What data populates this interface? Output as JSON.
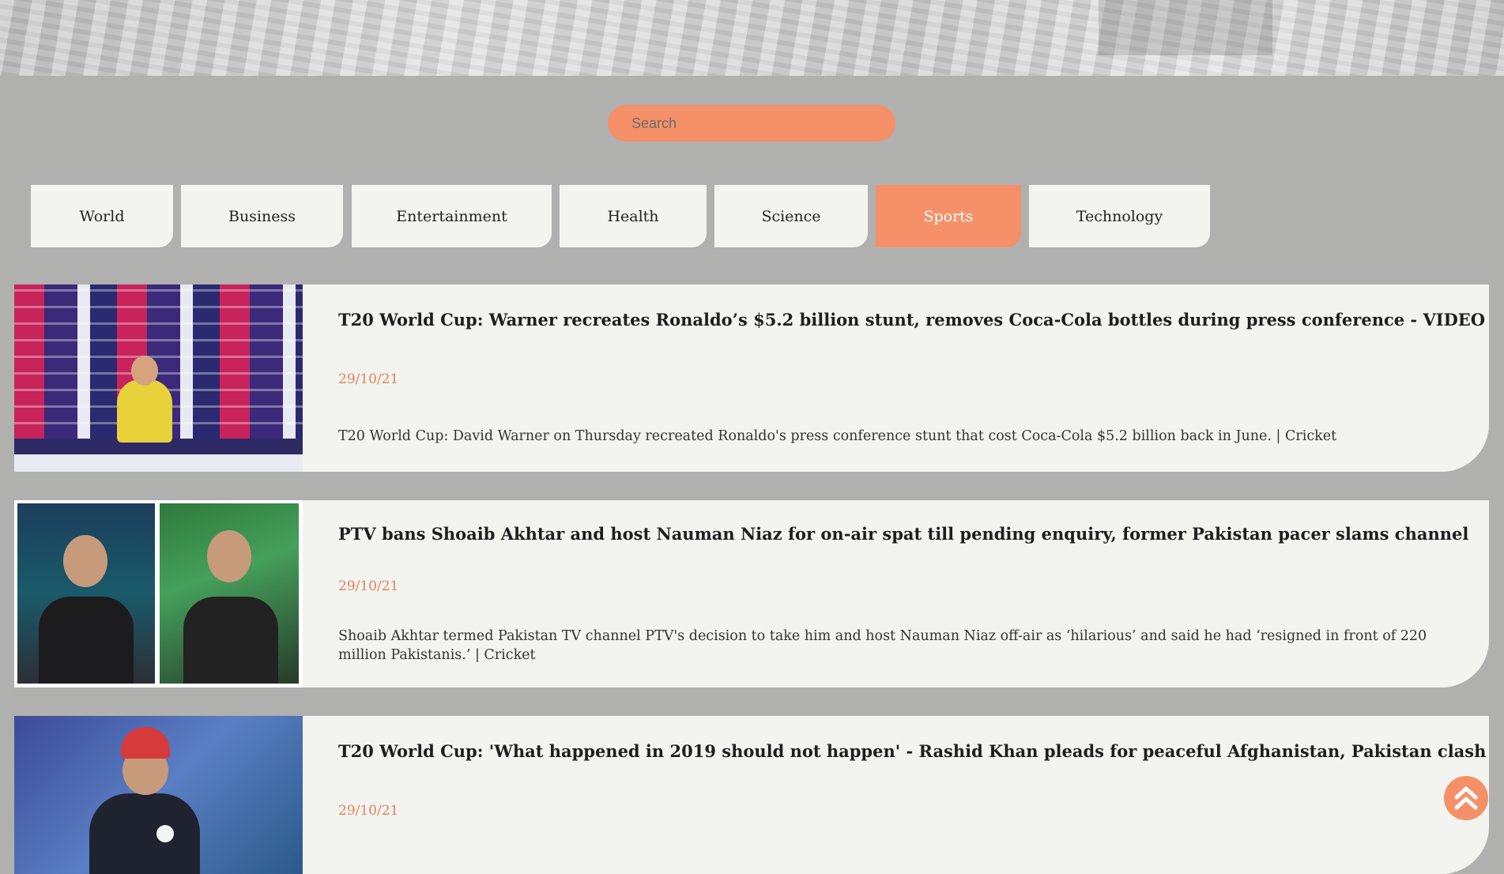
{
  "search": {
    "placeholder": "Search"
  },
  "nav": {
    "tabs": [
      {
        "label": "World",
        "active": false
      },
      {
        "label": "Business",
        "active": false
      },
      {
        "label": "Entertainment",
        "active": false
      },
      {
        "label": "Health",
        "active": false
      },
      {
        "label": "Science",
        "active": false
      },
      {
        "label": "Sports",
        "active": true
      },
      {
        "label": "Technology",
        "active": false
      }
    ]
  },
  "articles": [
    {
      "title": "T20 World Cup: Warner recreates Ronaldo’s $5.2 billion stunt, removes Coca-Cola bottles during press conference - VIDEO",
      "date": "29/10/21",
      "description": "T20 World Cup: David Warner on Thursday recreated Ronaldo's press conference stunt that cost Coca-Cola $5.2 billion back in June. | Cricket"
    },
    {
      "title": "PTV bans Shoaib Akhtar and host Nauman Niaz for on-air spat till pending enquiry, former Pakistan pacer slams channel",
      "date": "29/10/21",
      "description": "Shoaib Akhtar termed Pakistan TV channel PTV's decision to take him and host Nauman Niaz off-air as ‘hilarious’ and said he had ‘resigned in front of 220 million Pakistanis.’ | Cricket"
    },
    {
      "title": "T20 World Cup: 'What happened in 2019 should not happen' - Rashid Khan pleads for peaceful Afghanistan, Pakistan clash",
      "date": "29/10/21",
      "description": ""
    }
  ],
  "colors": {
    "accent": "#f59068",
    "background": "#b0b0af",
    "card": "#f3f3ef",
    "date": "#e2825f"
  },
  "icons": {
    "scroll_top": "double-chevron-up-icon"
  }
}
